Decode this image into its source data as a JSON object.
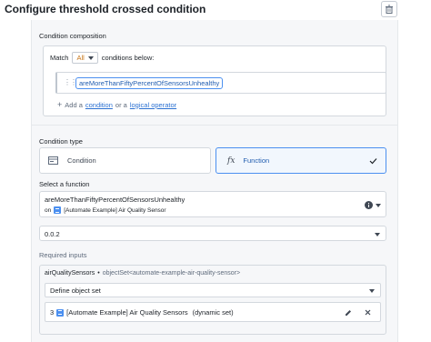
{
  "header": {
    "title": "Configure threshold crossed condition"
  },
  "composition": {
    "label": "Condition composition",
    "match_label": "Match",
    "match_value": "All",
    "match_suffix": "conditions below:",
    "condition_chip": "areMoreThanFiftyPercentOfSensorsUnhealthy",
    "add_prefix": "Add a",
    "add_condition": "condition",
    "add_or": "or a",
    "add_operator": "logical operator"
  },
  "condition_type": {
    "label": "Condition type",
    "options": [
      {
        "label": "Condition",
        "icon": "form-icon"
      },
      {
        "label": "Function",
        "icon": "fx-icon",
        "selected": true
      }
    ],
    "fx_symbol": "fx"
  },
  "function": {
    "label": "Select a function",
    "name": "areMoreThanFiftyPercentOfSensorsUnhealthy",
    "on_label": "on",
    "on_value": "[Automate Example] Air Quality Sensor",
    "version": "0.0.2"
  },
  "required": {
    "label": "Required inputs",
    "param_name": "airQualitySensors",
    "param_sep": "•",
    "param_type": "objectSet<automate-example-air-quality-sensor>",
    "define_select": "Define object set",
    "set_count": "3",
    "set_name": "[Automate Example] Air Quality Sensors",
    "set_kind": "(dynamic set)"
  },
  "colors": {
    "accent": "#2d72d2",
    "warning": "#c87619",
    "chip_border": "#4c90f0"
  }
}
